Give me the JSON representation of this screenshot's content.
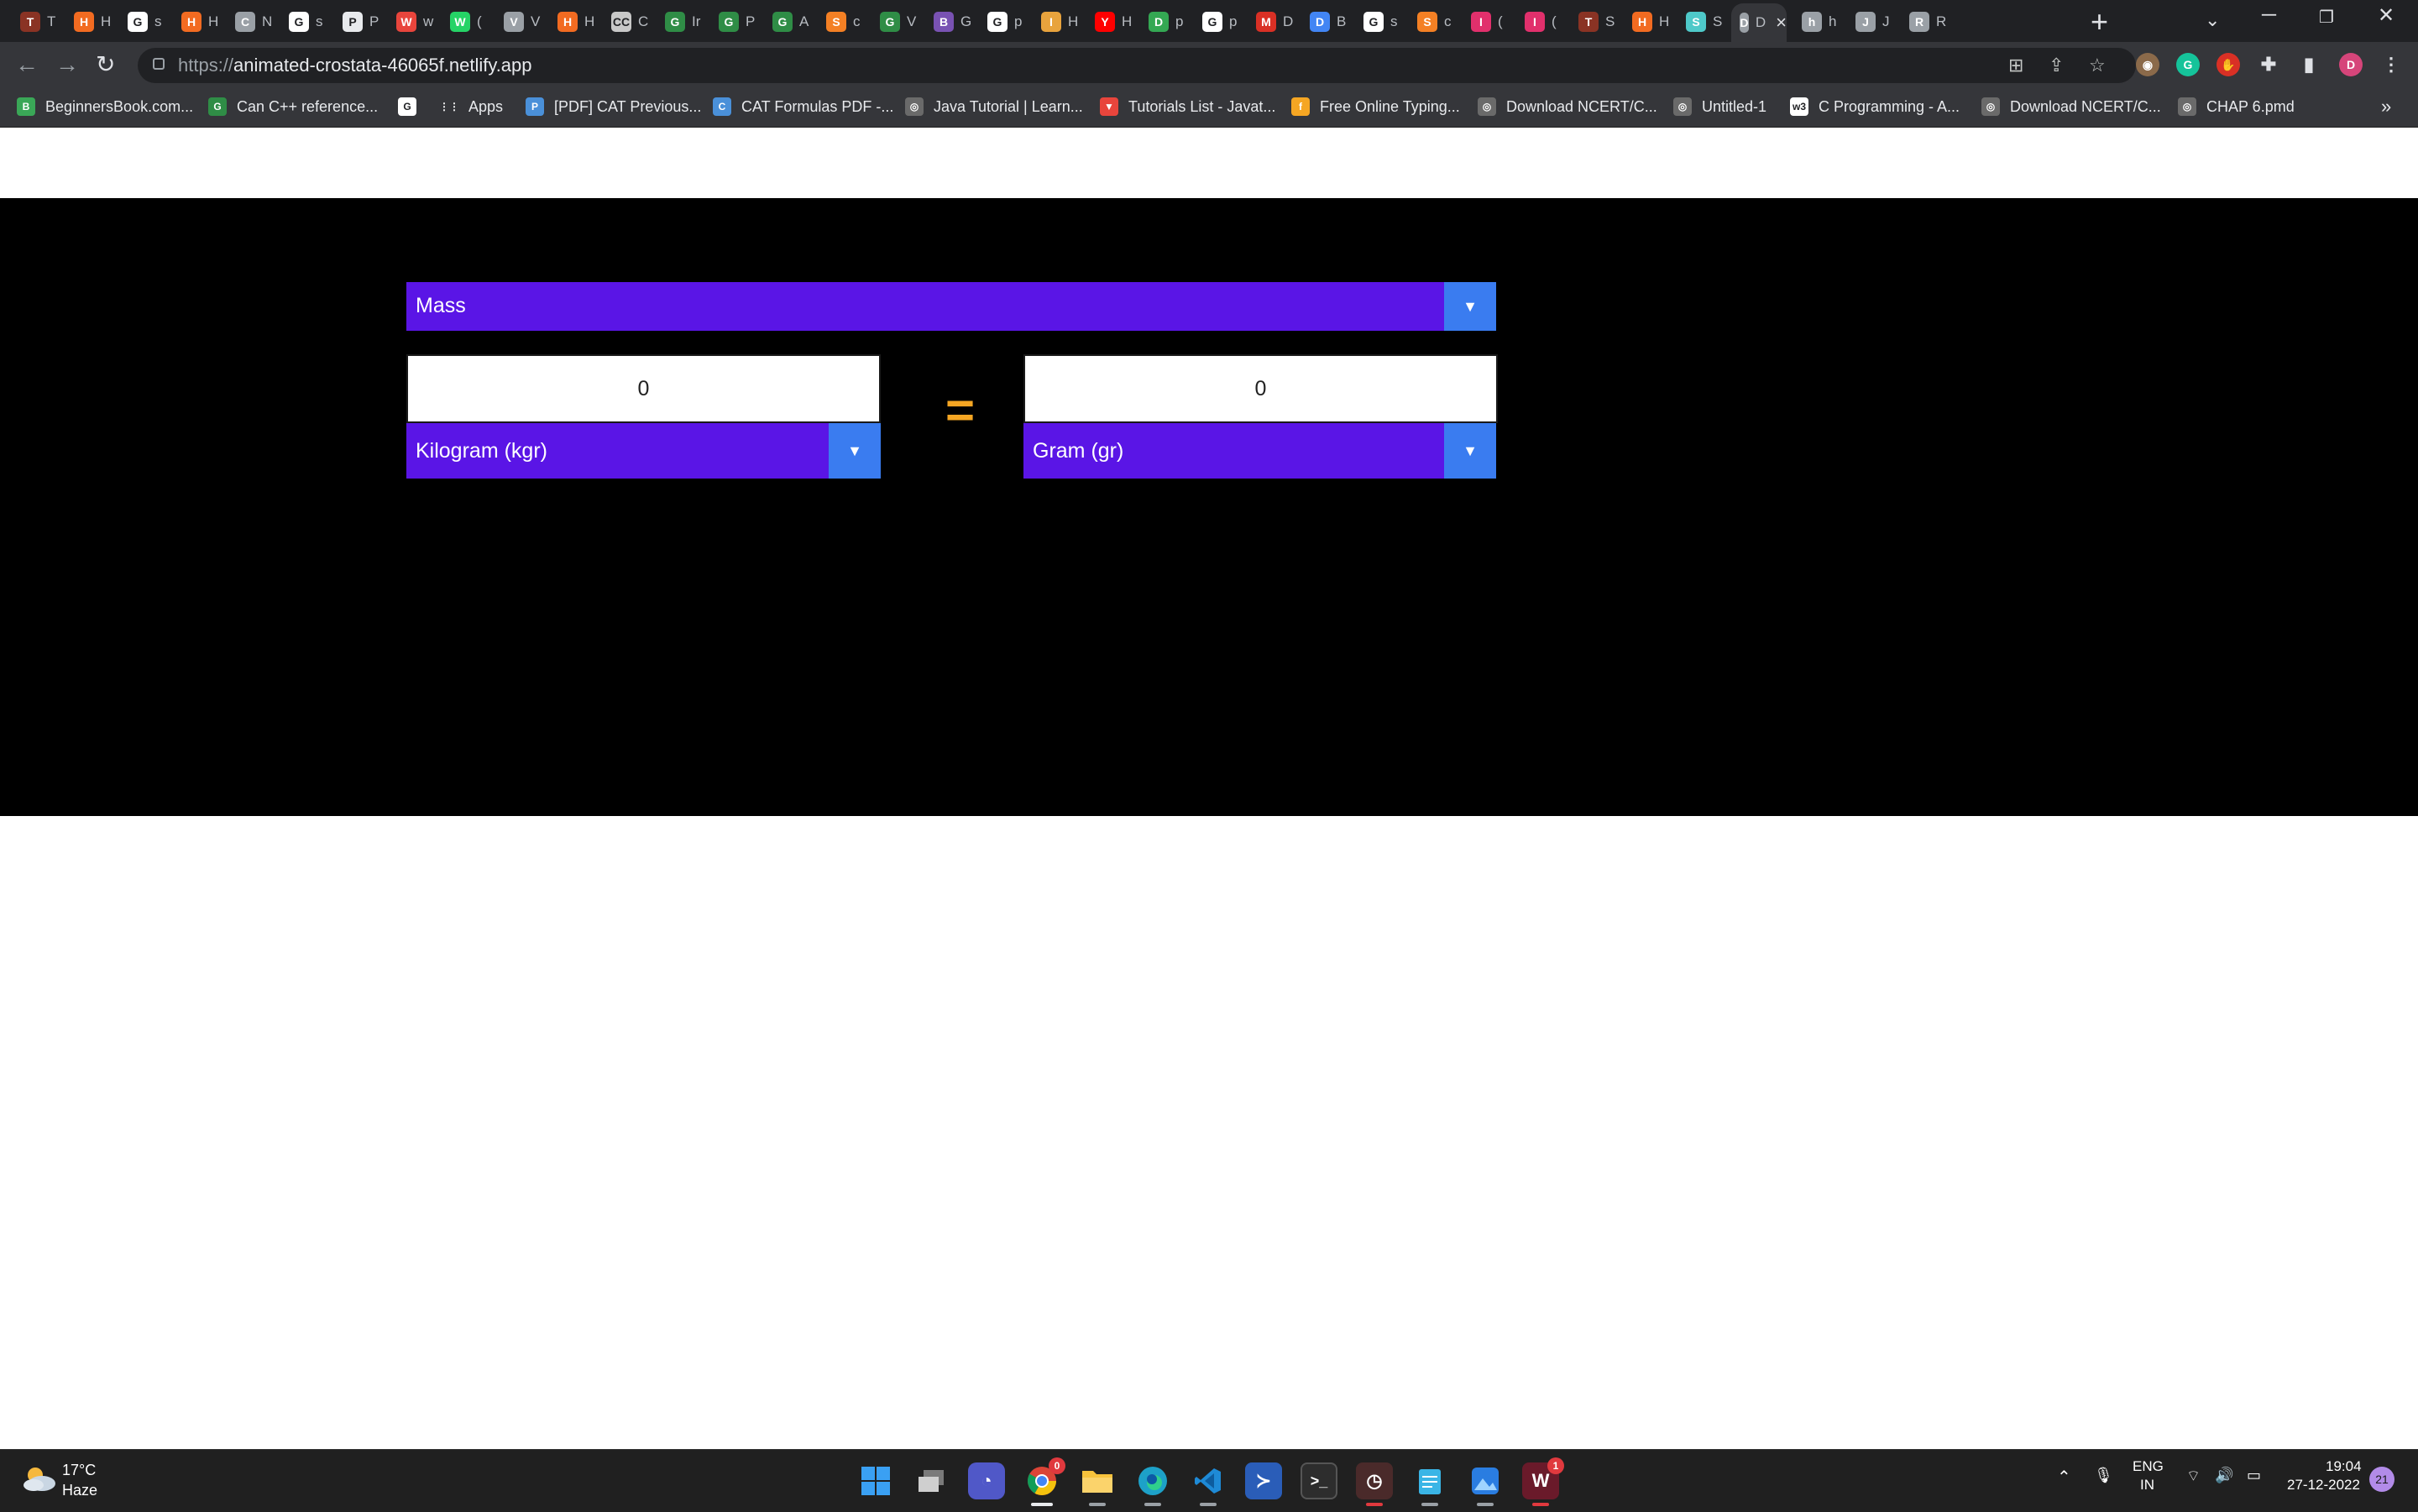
{
  "browser": {
    "tabs": [
      {
        "letter": "T",
        "color": "#8a3324",
        "title": "T"
      },
      {
        "letter": "H",
        "color": "#f26b21",
        "title": "H"
      },
      {
        "letter": "G",
        "color": "#ffffff",
        "title": "s"
      },
      {
        "letter": "H",
        "color": "#f26b21",
        "title": "H"
      },
      {
        "letter": "C",
        "color": "#9aa0a6",
        "title": "N"
      },
      {
        "letter": "G",
        "color": "#ffffff",
        "title": "s"
      },
      {
        "letter": "P",
        "color": "#e8eaed",
        "title": "P"
      },
      {
        "letter": "W",
        "color": "#e8453c",
        "title": "w"
      },
      {
        "letter": "W",
        "color": "#25d366",
        "title": "("
      },
      {
        "letter": "V",
        "color": "#9aa0a6",
        "title": "V"
      },
      {
        "letter": "H",
        "color": "#f26b21",
        "title": "H"
      },
      {
        "letter": "CC",
        "color": "#c8c8c8",
        "title": "C"
      },
      {
        "letter": "G",
        "color": "#2f8d46",
        "title": "Ir"
      },
      {
        "letter": "G",
        "color": "#2f8d46",
        "title": "P"
      },
      {
        "letter": "G",
        "color": "#2f8d46",
        "title": "A"
      },
      {
        "letter": "S",
        "color": "#f48024",
        "title": "c"
      },
      {
        "letter": "G",
        "color": "#2f8d46",
        "title": "V"
      },
      {
        "letter": "B",
        "color": "#7952b3",
        "title": "G"
      },
      {
        "letter": "G",
        "color": "#ffffff",
        "title": "p"
      },
      {
        "letter": "I",
        "color": "#e8a33d",
        "title": "H"
      },
      {
        "letter": "Y",
        "color": "#ff0000",
        "title": "H"
      },
      {
        "letter": "D",
        "color": "#34a853",
        "title": "p"
      },
      {
        "letter": "G",
        "color": "#ffffff",
        "title": "p"
      },
      {
        "letter": "M",
        "color": "#d93025",
        "title": "D"
      },
      {
        "letter": "D",
        "color": "#4285f4",
        "title": "B"
      },
      {
        "letter": "G",
        "color": "#ffffff",
        "title": "s"
      },
      {
        "letter": "S",
        "color": "#f48024",
        "title": "c"
      },
      {
        "letter": "I",
        "color": "#e1306c",
        "title": "("
      },
      {
        "letter": "I",
        "color": "#e1306c",
        "title": "("
      },
      {
        "letter": "T",
        "color": "#8a3324",
        "title": "S"
      },
      {
        "letter": "H",
        "color": "#f26b21",
        "title": "H"
      },
      {
        "letter": "S",
        "color": "#4ec9c9",
        "title": "S"
      },
      {
        "letter": "D",
        "color": "#9aa0a6",
        "title": "D",
        "active": true
      },
      {
        "letter": "h",
        "color": "#9aa0a6",
        "title": "h"
      },
      {
        "letter": "J",
        "color": "#9aa0a6",
        "title": "J"
      },
      {
        "letter": "R",
        "color": "#9aa0a6",
        "title": "R"
      }
    ],
    "new_tab_label": "+",
    "url_scheme": "https://",
    "url_host": "animated-crostata-46065f.netlify.app",
    "bookmarks": [
      {
        "label": "BeginnersBook.com...",
        "icon": "B",
        "color": "#3aa757"
      },
      {
        "label": "Can C++ reference...",
        "icon": "G",
        "color": "#2f8d46"
      },
      {
        "label": "",
        "icon": "G",
        "color": "#ffffff"
      },
      {
        "label": "Apps",
        "icon": "⋮⋮",
        "color": "#35363a"
      },
      {
        "label": "[PDF] CAT Previous...",
        "icon": "P",
        "color": "#4a90d9"
      },
      {
        "label": "CAT Formulas PDF -...",
        "icon": "C",
        "color": "#4a90d9"
      },
      {
        "label": "Java Tutorial | Learn...",
        "icon": "◎",
        "color": "#6a6a6a"
      },
      {
        "label": "Tutorials List - Javat...",
        "icon": "▼",
        "color": "#e8453c"
      },
      {
        "label": "Free Online Typing...",
        "icon": "f",
        "color": "#f5a623"
      },
      {
        "label": "Download NCERT/C...",
        "icon": "◎",
        "color": "#6a6a6a"
      },
      {
        "label": "Untitled-1",
        "icon": "◎",
        "color": "#6a6a6a"
      },
      {
        "label": "C Programming - A...",
        "icon": "w3",
        "color": "#ffffff"
      },
      {
        "label": "Download NCERT/C...",
        "icon": "◎",
        "color": "#6a6a6a"
      },
      {
        "label": "CHAP 6.pmd",
        "icon": "◎",
        "color": "#6a6a6a"
      }
    ],
    "profile_initial": "D"
  },
  "converter": {
    "category": "Mass",
    "from_value": "0",
    "from_unit": "Kilogram (kgr)",
    "to_value": "0",
    "to_unit": "Gram (gr)",
    "equals": "=",
    "colors": {
      "select_bg": "#5a15e6",
      "arrow_bg": "#3a7cf0",
      "equals": "#f5a623",
      "stage": "#000000"
    }
  },
  "taskbar": {
    "temperature": "17°C",
    "condition": "Haze",
    "language": "ENG",
    "region": "IN",
    "time": "19:04",
    "date": "27-12-2022",
    "notifications": "21",
    "chrome_badge": "0",
    "app_badge": "1"
  }
}
